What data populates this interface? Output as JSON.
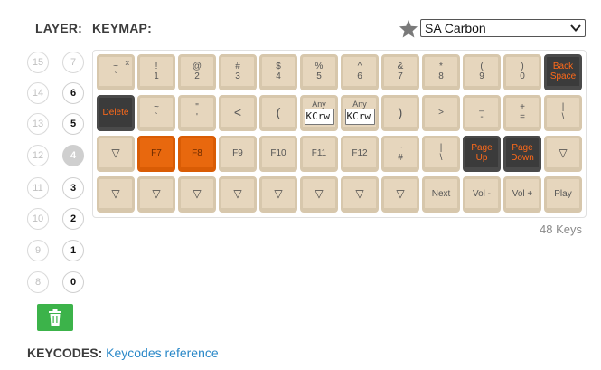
{
  "header": {
    "layer_label": "LAYER:",
    "keymap_label": "KEYMAP:"
  },
  "theme_select": {
    "value": "SA Carbon"
  },
  "layers": [
    {
      "left": "15",
      "right": "7"
    },
    {
      "left": "14",
      "right": "6"
    },
    {
      "left": "13",
      "right": "5"
    },
    {
      "left": "12",
      "right": "4"
    },
    {
      "left": "11",
      "right": "3"
    },
    {
      "left": "10",
      "right": "2"
    },
    {
      "left": "9",
      "right": "1"
    },
    {
      "left": "8",
      "right": "0"
    }
  ],
  "active_layer": "4",
  "keys": {
    "r0": [
      {
        "top": "~",
        "bottom": "`",
        "x": "x"
      },
      {
        "top": "!",
        "bottom": "1"
      },
      {
        "top": "@",
        "bottom": "2"
      },
      {
        "top": "#",
        "bottom": "3"
      },
      {
        "top": "$",
        "bottom": "4"
      },
      {
        "top": "%",
        "bottom": "5"
      },
      {
        "top": "^",
        "bottom": "6"
      },
      {
        "top": "&",
        "bottom": "7"
      },
      {
        "top": "*",
        "bottom": "8"
      },
      {
        "top": "(",
        "bottom": "9"
      },
      {
        "top": ")",
        "bottom": "0"
      },
      {
        "top": "Back",
        "bottom": "Space"
      }
    ],
    "r1": [
      {
        "label": "Delete"
      },
      {
        "top": "~",
        "bottom": "`"
      },
      {
        "top": "\"",
        "bottom": "'"
      },
      {
        "label": "<"
      },
      {
        "label": "("
      },
      {
        "any_label": "Any",
        "any_value": "KCrw"
      },
      {
        "any_label": "Any",
        "any_value": "KCrw"
      },
      {
        "label": ")"
      },
      {
        "label": ">"
      },
      {
        "top": "_",
        "bottom": "-"
      },
      {
        "top": "+",
        "bottom": "="
      },
      {
        "top": "|",
        "bottom": "\\"
      }
    ],
    "r2": [
      {
        "label": "▽"
      },
      {
        "label": "F7"
      },
      {
        "label": "F8"
      },
      {
        "label": "F9"
      },
      {
        "label": "F10"
      },
      {
        "label": "F11"
      },
      {
        "label": "F12"
      },
      {
        "top": "~",
        "bottom": "#"
      },
      {
        "top": "|",
        "bottom": "\\"
      },
      {
        "top": "Page",
        "bottom": "Up"
      },
      {
        "top": "Page",
        "bottom": "Down"
      },
      {
        "label": "▽"
      }
    ],
    "r3": [
      {
        "label": "▽"
      },
      {
        "label": "▽"
      },
      {
        "label": "▽"
      },
      {
        "label": "▽"
      },
      {
        "label": "▽"
      },
      {
        "label": "▽"
      },
      {
        "label": "▽"
      },
      {
        "label": "▽"
      },
      {
        "label": "Next"
      },
      {
        "label": "Vol -"
      },
      {
        "label": "Vol +"
      },
      {
        "label": "Play"
      }
    ]
  },
  "keys_count": "48 Keys",
  "footer": {
    "label": "KEYCODES:",
    "link": "Keycodes reference"
  },
  "colors": {
    "accent_orange": "#e8680e",
    "dark_key": "#3b3b3b",
    "keycap": "#e6d6bd",
    "trash_green": "#3cb34a",
    "link": "#2a88c8"
  },
  "icons": {
    "star": "star-icon",
    "trash": "trash-icon",
    "dropdown": "chevron-down-icon"
  }
}
